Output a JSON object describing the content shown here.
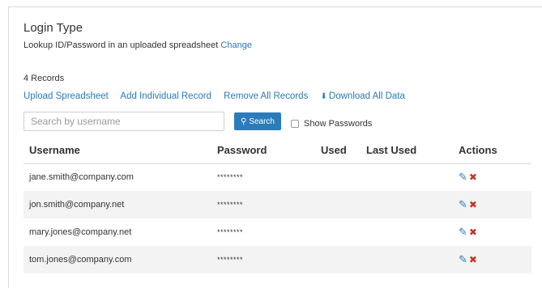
{
  "login_type": {
    "title": "Login Type",
    "description": "Lookup ID/Password in an uploaded spreadsheet",
    "change_label": "Change"
  },
  "records_count": "4 Records",
  "actions_bar": {
    "upload": "Upload Spreadsheet",
    "add": "Add Individual Record",
    "remove": "Remove All Records",
    "download": "Download All Data"
  },
  "search": {
    "placeholder": "Search by username",
    "button_label": "Search",
    "show_passwords_label": "Show Passwords"
  },
  "table": {
    "headers": {
      "username": "Username",
      "password": "Password",
      "used": "Used",
      "last_used": "Last Used",
      "actions": "Actions"
    },
    "rows": [
      {
        "username": "jane.smith@company.com",
        "password": "********",
        "used": "",
        "last_used": ""
      },
      {
        "username": "jon.smith@company.net",
        "password": "********",
        "used": "",
        "last_used": ""
      },
      {
        "username": "mary.jones@company.net",
        "password": "********",
        "used": "",
        "last_used": ""
      },
      {
        "username": "tom.jones@company.com",
        "password": "********",
        "used": "",
        "last_used": ""
      }
    ]
  },
  "icons": {
    "search": "search-icon",
    "download": "download-icon",
    "edit": "pencil-icon",
    "delete": "delete-x-icon"
  },
  "colors": {
    "link": "#2a7ab8",
    "button": "#2b7bbc",
    "delete": "#c0392b",
    "stripe": "#f3f3f3"
  }
}
